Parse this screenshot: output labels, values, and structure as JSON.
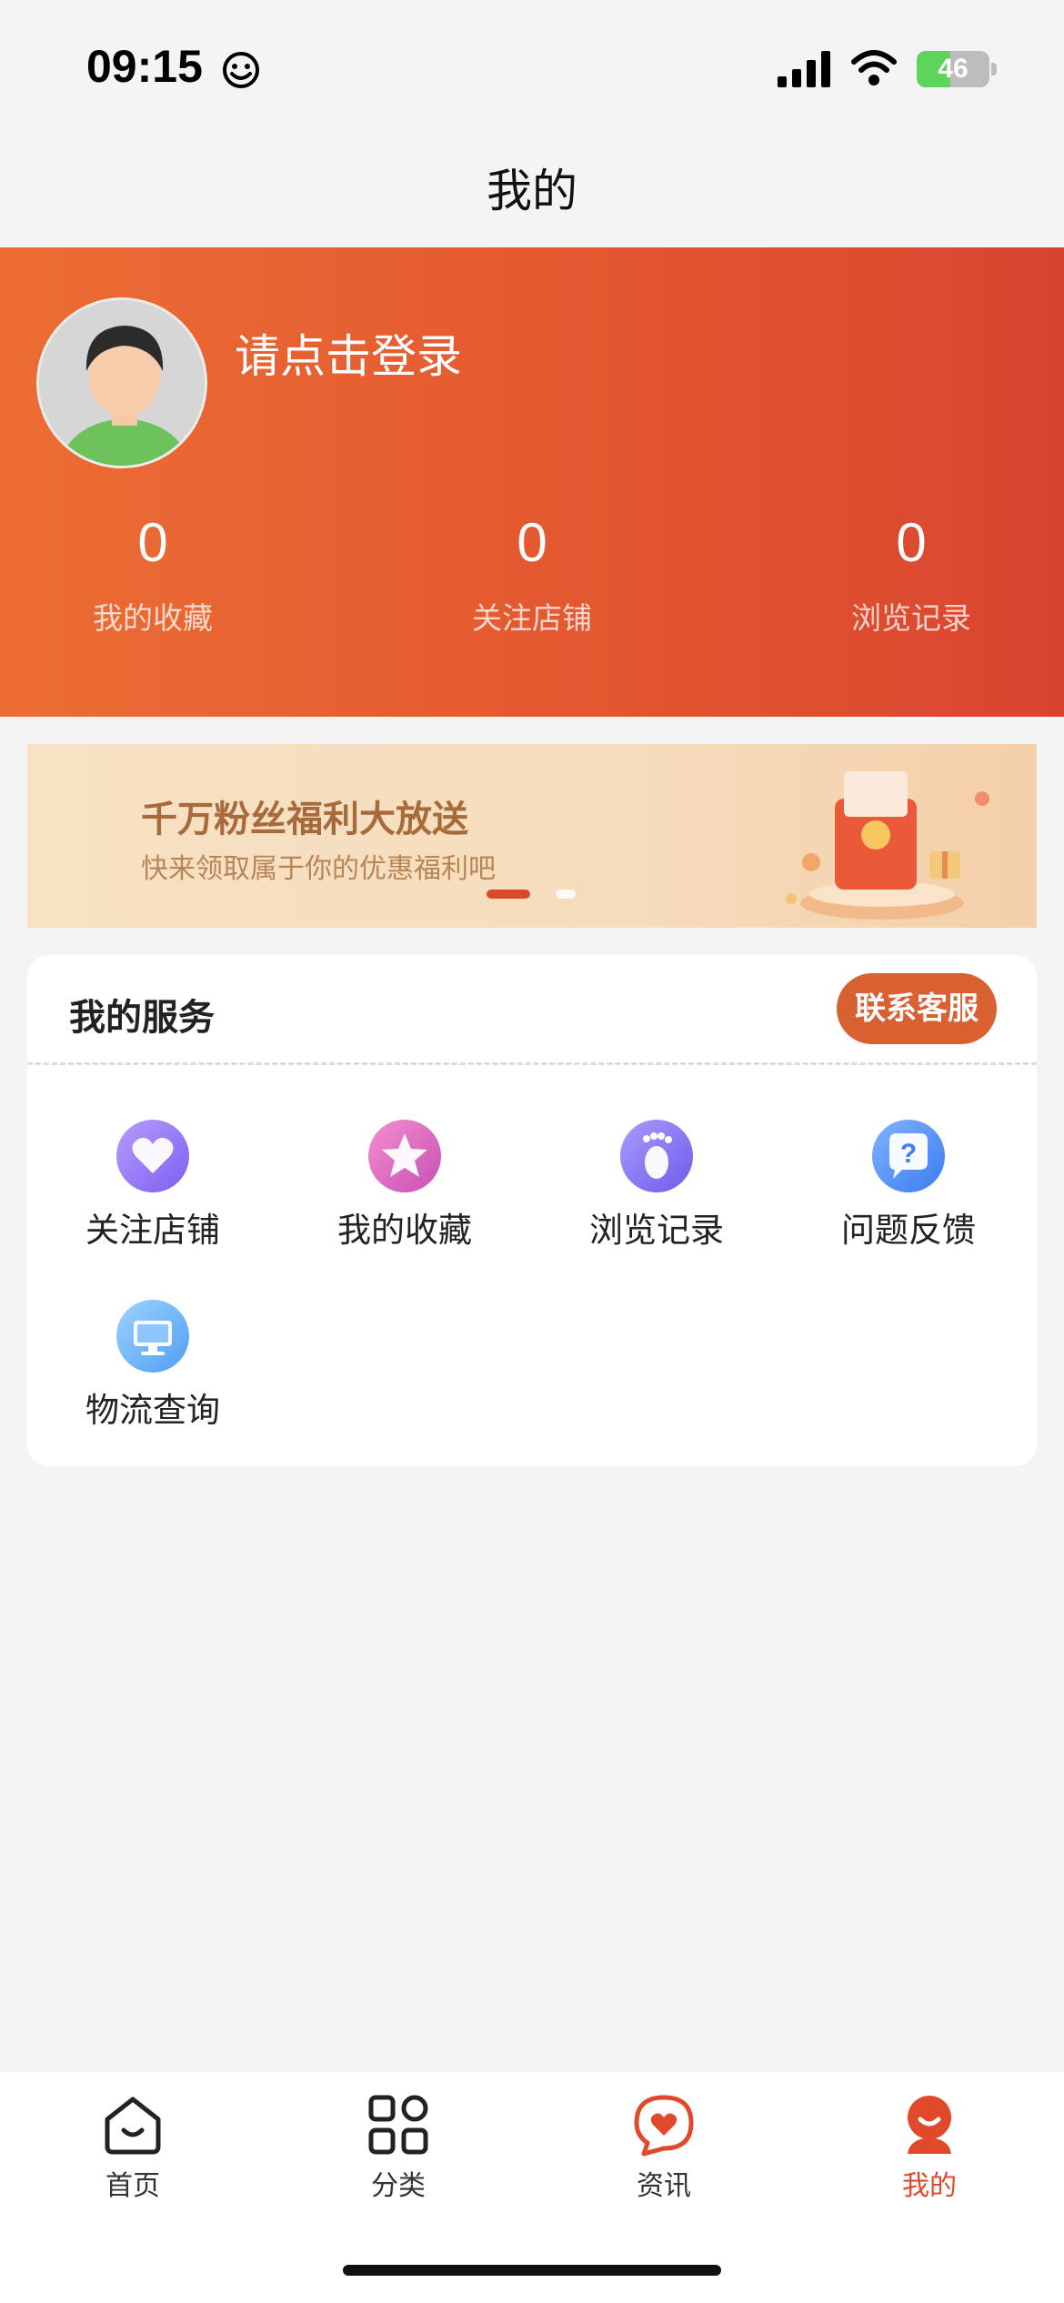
{
  "status_bar": {
    "time": "09:15",
    "battery": "46",
    "battery_level": 0.46
  },
  "nav": {
    "title": "我的"
  },
  "profile": {
    "login_prompt": "请点击登录",
    "stats": [
      {
        "value": "0",
        "label": "我的收藏"
      },
      {
        "value": "0",
        "label": "关注店铺"
      },
      {
        "value": "0",
        "label": "浏览记录"
      }
    ]
  },
  "banner": {
    "title": "千万粉丝福利大放送",
    "subtitle": "快来领取属于你的优惠福利吧",
    "active_slide": 1,
    "slide_count": 2
  },
  "services": {
    "title": "我的服务",
    "contact_button": "联系客服",
    "items": [
      {
        "label": "关注店铺",
        "icon": "heart-icon"
      },
      {
        "label": "我的收藏",
        "icon": "star-icon"
      },
      {
        "label": "浏览记录",
        "icon": "footprint-icon"
      },
      {
        "label": "问题反馈",
        "icon": "question-chat-icon"
      },
      {
        "label": "物流查询",
        "icon": "monitor-icon"
      }
    ]
  },
  "tab_bar": {
    "tabs": [
      {
        "label": "首页",
        "icon": "home-icon"
      },
      {
        "label": "分类",
        "icon": "grid-icon"
      },
      {
        "label": "资讯",
        "icon": "news-heart-icon"
      },
      {
        "label": "我的",
        "icon": "profile-icon",
        "active": true
      }
    ]
  },
  "colors": {
    "accent": "#e04a2b",
    "header_start": "#ec6d34",
    "header_end": "#d9442f",
    "contact_button": "#d96031"
  }
}
